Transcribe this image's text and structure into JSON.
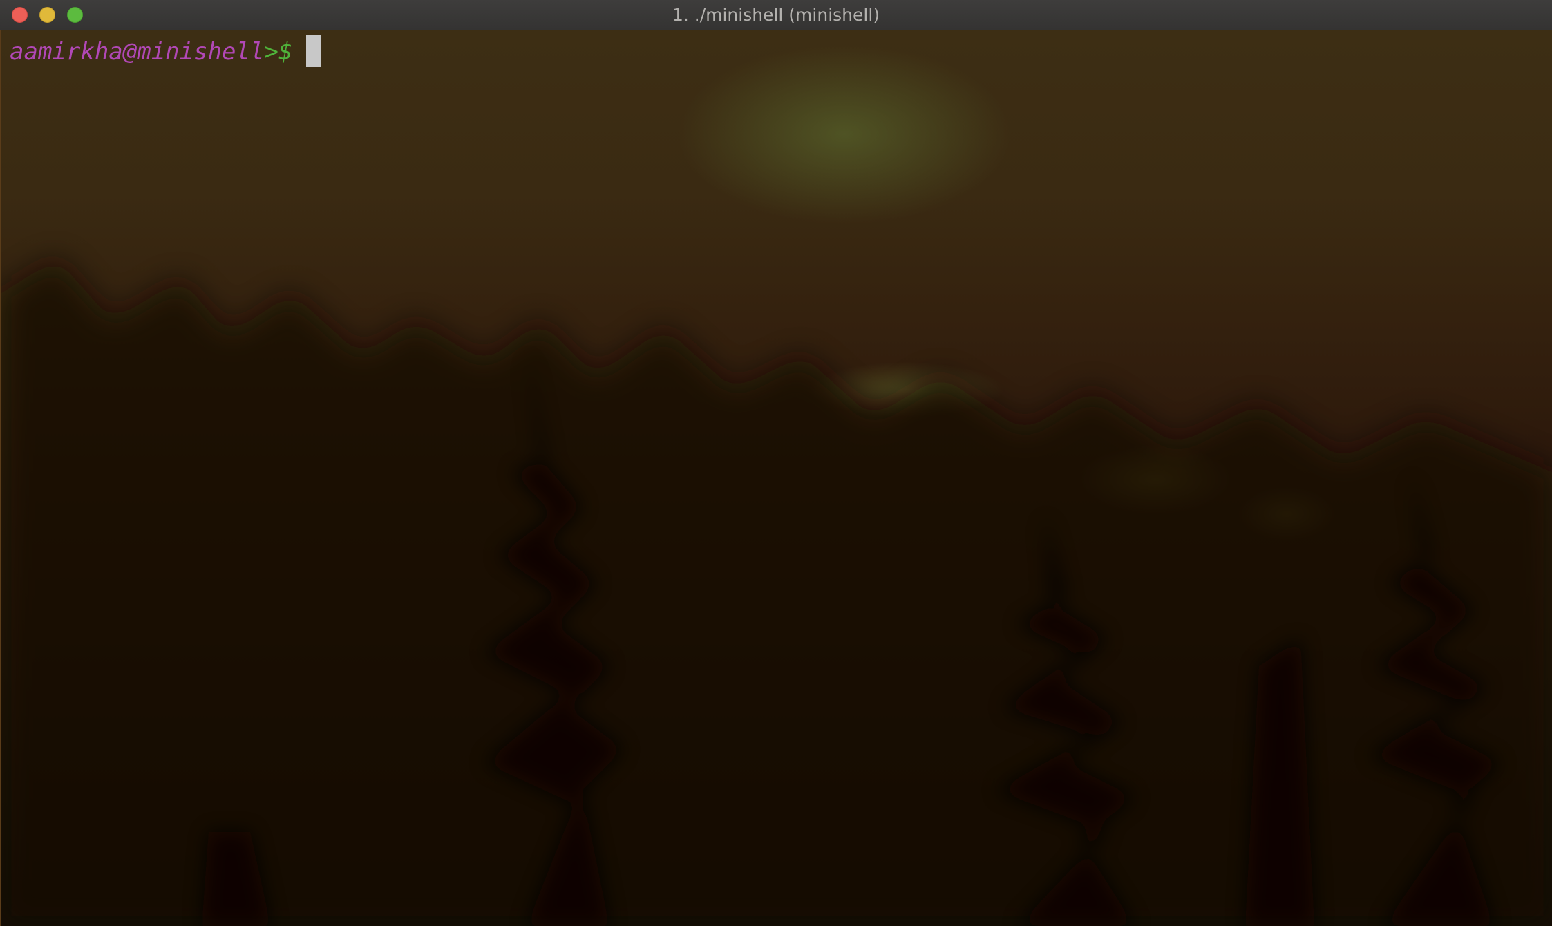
{
  "window": {
    "title": "1. ./minishell (minishell)",
    "buttons": {
      "close": "close",
      "minimize": "minimize",
      "zoom": "zoom"
    }
  },
  "terminal": {
    "prompt": {
      "user_host": "aamirkha@minishell",
      "symbol": ">$"
    },
    "input": "",
    "colors": {
      "prompt_user": "#b148b6",
      "prompt_symbol": "#4fb33a",
      "cursor": "#c8c8c8"
    }
  }
}
